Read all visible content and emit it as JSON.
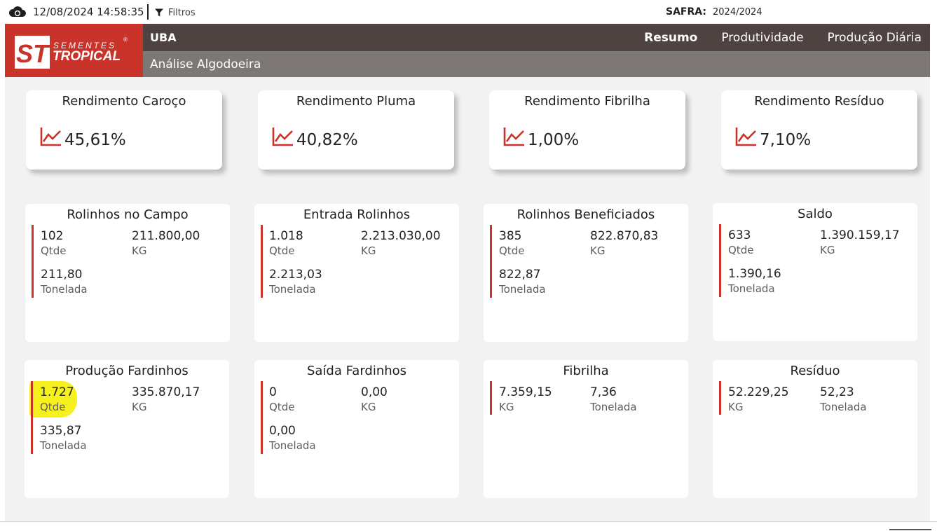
{
  "topbar": {
    "datetime": "12/08/2024 14:58:35",
    "filter_label": "Filtros",
    "safra_label": "SAFRA:",
    "safra_value": "2024/2024"
  },
  "logo": {
    "mark": "ST",
    "brand_top": "SEMENTES",
    "brand_bottom": "TROPICAL",
    "registered": "®"
  },
  "header": {
    "title": "UBA",
    "subtitle": "Análise Algodoeira",
    "tabs": [
      {
        "label": "Resumo",
        "active": true
      },
      {
        "label": "Produtividade",
        "active": false
      },
      {
        "label": "Produção Diária",
        "active": false
      }
    ]
  },
  "colors": {
    "accent": "#c9332a",
    "header_dark": "#4f4341",
    "header_light": "#7d7876",
    "highlight": "#f7f01f"
  },
  "kpis": [
    {
      "title": "Rendimento Caroço",
      "value": "45,61%",
      "icon": "trend-up-icon"
    },
    {
      "title": "Rendimento Pluma",
      "value": "40,82%",
      "icon": "trend-up-icon"
    },
    {
      "title": "Rendimento Fibrilha",
      "value": "1,00%",
      "icon": "trend-up-icon"
    },
    {
      "title": "Rendimento Resíduo",
      "value": "7,10%",
      "icon": "trend-up-icon"
    }
  ],
  "cards": {
    "rolinhos_campo": {
      "title": "Rolinhos no Campo",
      "m1": {
        "value": "102",
        "label": "Qtde"
      },
      "m2": {
        "value": "211.800,00",
        "label": "KG"
      },
      "m3": {
        "value": "211,80",
        "label": "Tonelada"
      }
    },
    "entrada_rolinhos": {
      "title": "Entrada Rolinhos",
      "m1": {
        "value": "1.018",
        "label": "Qtde"
      },
      "m2": {
        "value": "2.213.030,00",
        "label": "KG"
      },
      "m3": {
        "value": "2.213,03",
        "label": "Tonelada"
      }
    },
    "rolinhos_beneficiados": {
      "title": "Rolinhos Beneficiados",
      "m1": {
        "value": "385",
        "label": "Qtde"
      },
      "m2": {
        "value": "822.870,83",
        "label": "KG"
      },
      "m3": {
        "value": "822,87",
        "label": "Tonelada"
      }
    },
    "saldo": {
      "title": "Saldo",
      "m1": {
        "value": "633",
        "label": "Qtde"
      },
      "m2": {
        "value": "1.390.159,17",
        "label": "KG"
      },
      "m3": {
        "value": "1.390,16",
        "label": "Tonelada"
      }
    },
    "producao_fardinhos": {
      "title": "Produção Fardinhos",
      "m1": {
        "value": "1.727",
        "label": "Qtde"
      },
      "m2": {
        "value": "335.870,17",
        "label": "KG"
      },
      "m3": {
        "value": "335,87",
        "label": "Tonelada"
      }
    },
    "saida_fardinhos": {
      "title": "Saída Fardinhos",
      "m1": {
        "value": "0",
        "label": "Qtde"
      },
      "m2": {
        "value": "0,00",
        "label": "KG"
      },
      "m3": {
        "value": "0,00",
        "label": "Tonelada"
      }
    },
    "fibrilha": {
      "title": "Fibrilha",
      "m1": {
        "value": "7.359,15",
        "label": "KG"
      },
      "m2": {
        "value": "7,36",
        "label": "Tonelada"
      }
    },
    "residuo": {
      "title": "Resíduo",
      "m1": {
        "value": "52.229,25",
        "label": "KG"
      },
      "m2": {
        "value": "52,23",
        "label": "Tonelada"
      }
    }
  }
}
